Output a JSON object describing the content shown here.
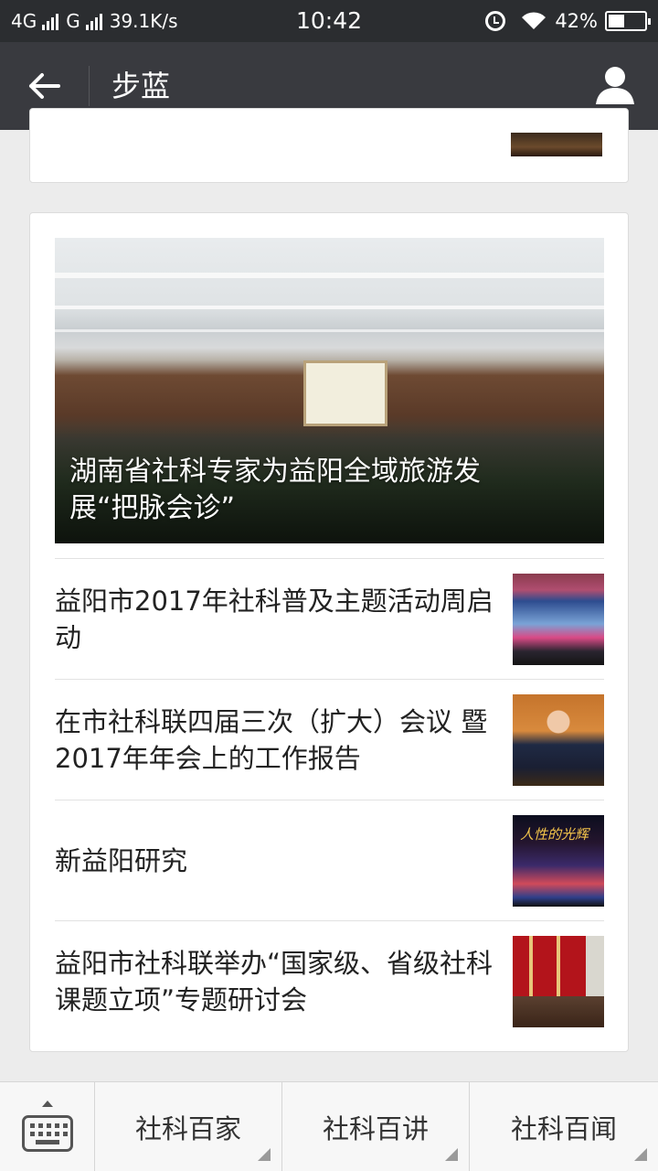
{
  "status_bar": {
    "network1": "4G",
    "network2": "G",
    "speed": "39.1K/s",
    "time": "10:42",
    "battery": "42%",
    "battery_level": 0.42
  },
  "header": {
    "title": "步蓝",
    "back_icon": "arrow-left-icon",
    "profile_icon": "person-icon"
  },
  "article_card": {
    "hero_title": "湖南省社科专家为益阳全域旅游发展“把脉会诊”",
    "items": [
      {
        "title": "益阳市2017年社科普及主题活动周启动"
      },
      {
        "title": "在市社科联四届三次（扩大）会议 暨2017年年会上的工作报告"
      },
      {
        "title": "新益阳研究",
        "thumb_caption": "人性的光辉"
      },
      {
        "title": "益阳市社科联举办“国家级、省级社科课题立项”专题研讨会"
      }
    ]
  },
  "bottom_menu": {
    "keyboard_icon": "keyboard-icon",
    "items": [
      {
        "label": "社科百家"
      },
      {
        "label": "社科百讲"
      },
      {
        "label": "社科百闻"
      }
    ]
  }
}
